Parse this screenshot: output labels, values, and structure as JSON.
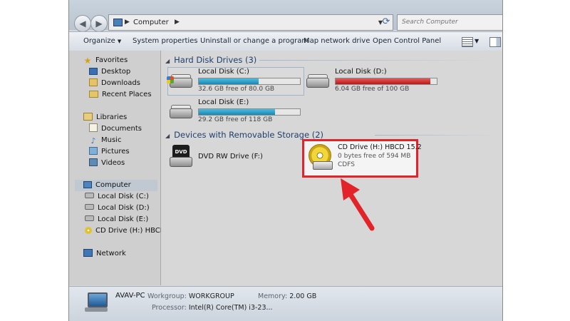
{
  "address": {
    "location": "Computer",
    "search_placeholder": "Search Computer"
  },
  "toolbar": {
    "organize": "Organize",
    "system_properties": "System properties",
    "uninstall": "Uninstall or change a program",
    "map_drive": "Map network drive",
    "control_panel": "Open Control Panel"
  },
  "nav": {
    "favorites": "Favorites",
    "desktop": "Desktop",
    "downloads": "Downloads",
    "recent": "Recent Places",
    "libraries": "Libraries",
    "documents": "Documents",
    "music": "Music",
    "pictures": "Pictures",
    "videos": "Videos",
    "computer": "Computer",
    "local_c": "Local Disk (C:)",
    "local_d": "Local Disk (D:)",
    "local_e": "Local Disk (E:)",
    "cd_drive": "CD Drive (H:) HBCD",
    "network": "Network"
  },
  "hard_disks": {
    "heading": "Hard Disk Drives (3)",
    "drives": [
      {
        "name": "Local Disk (C:)",
        "free": "32.6 GB free of 80.0 GB",
        "used_fraction": 0.59,
        "bar_color": "#1b86b3"
      },
      {
        "name": "Local Disk (D:)",
        "free": "6.04 GB free of 100 GB",
        "used_fraction": 0.94,
        "bar_color": "#b51a1a"
      },
      {
        "name": "Local Disk (E:)",
        "free": "29.2 GB free of 118 GB",
        "used_fraction": 0.75,
        "bar_color": "#1b86b3"
      }
    ]
  },
  "removable": {
    "heading": "Devices with Removable Storage (2)",
    "dvd": {
      "name": "DVD RW Drive (F:)",
      "label": "DVD"
    },
    "cd": {
      "name": "CD Drive (H:) HBCD 15.2",
      "free": "0 bytes free of 594 MB",
      "fs": "CDFS"
    }
  },
  "details": {
    "pc_name": "AVAV-PC",
    "workgroup_label": "Workgroup:",
    "workgroup": "WORKGROUP",
    "memory_label": "Memory:",
    "memory": "2.00 GB",
    "processor_label": "Processor:",
    "processor": "Intel(R) Core(TM) i3-23..."
  },
  "colors": {
    "highlight_border": "#e2242a",
    "arrow": "#e2242a"
  }
}
